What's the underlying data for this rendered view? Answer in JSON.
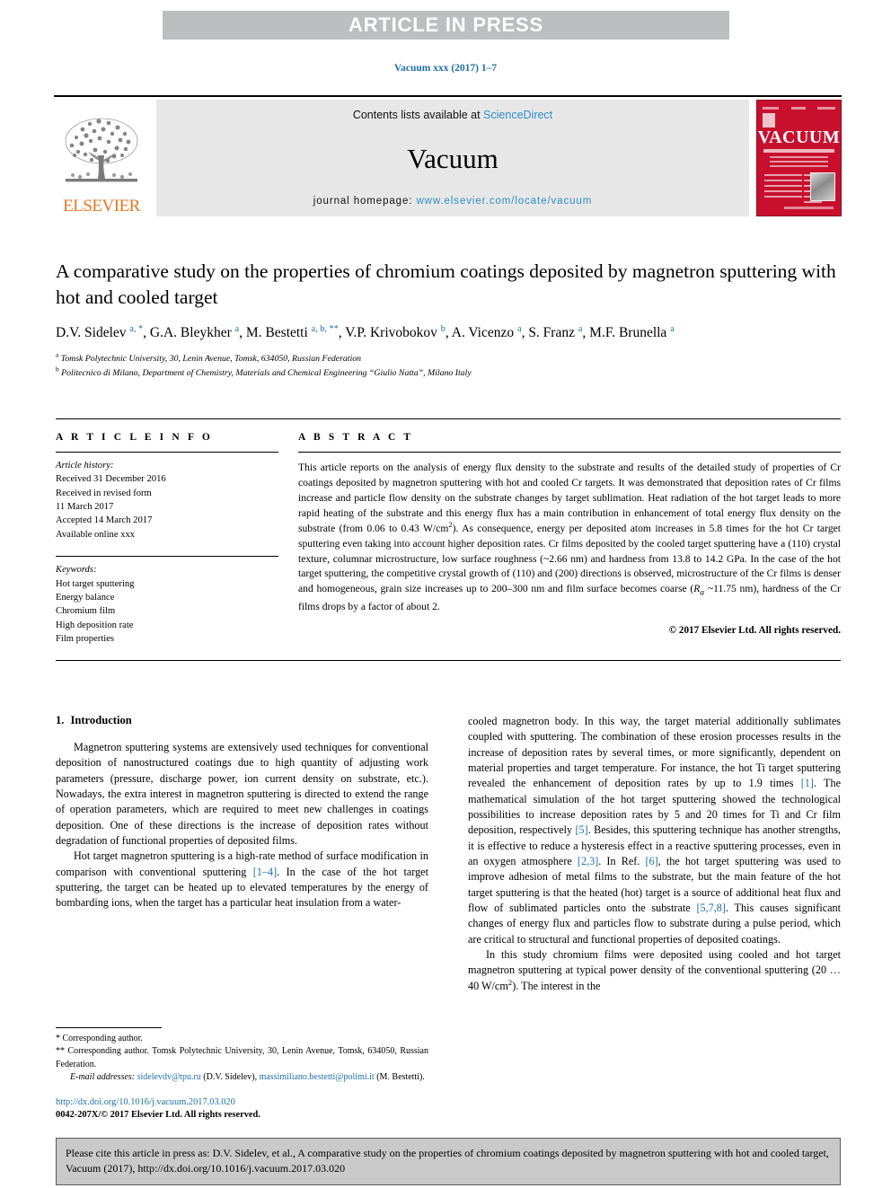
{
  "banner": {
    "text": "ARTICLE IN PRESS"
  },
  "running_head": "Vacuum xxx (2017) 1–7",
  "masthead": {
    "publisher": "ELSEVIER",
    "contents_prefix": "Contents lists available at ",
    "contents_link": "ScienceDirect",
    "journal_title": "Vacuum",
    "homepage_prefix": "journal homepage: ",
    "homepage_url": "www.elsevier.com/locate/vacuum",
    "cover_title": "VACUUM",
    "brand_red": "#c8102e",
    "brand_orange": "#e87722",
    "link_blue": "#2b8ec4"
  },
  "article": {
    "title": "A comparative study on the properties of chromium coatings deposited by magnetron sputtering with hot and cooled target",
    "authors_html": "D.V. Sidelev <sup>a, *</sup>, G.A. Bleykher <sup>a</sup>, M. Bestetti <sup>a, b, **</sup>, V.P. Krivobokov <sup>b</sup>, A. Vicenzo <sup>a</sup>, S. Franz <sup>a</sup>, M.F. Brunella <sup>a</sup>",
    "affiliation_a": "Tomsk Polytechnic University, 30, Lenin Avenue, Tomsk, 634050, Russian Federation",
    "affiliation_b": "Politecnico di Milano, Department of Chemistry, Materials and Chemical Engineering “Giulio Natta”, Milano Italy"
  },
  "info": {
    "heading": "A R T I C L E   I N F O",
    "history_label": "Article history:",
    "history": [
      "Received 31 December 2016",
      "Received in revised form",
      "11 March 2017",
      "Accepted 14 March 2017",
      "Available online xxx"
    ],
    "keywords_label": "Keywords:",
    "keywords": [
      "Hot target sputtering",
      "Energy balance",
      "Chromium film",
      "High deposition rate",
      "Film properties"
    ]
  },
  "abstract": {
    "heading": "A B S T R A C T",
    "text_html": "This article reports on the analysis of energy flux density to the substrate and results of the detailed study of properties of Cr coatings deposited by magnetron sputtering with hot and cooled Cr targets. It was demonstrated that deposition rates of Cr films increase and particle flow density on the substrate changes by target sublimation. Heat radiation of the hot target leads to more rapid heating of the substrate and this energy flux has a main contribution in enhancement of total energy flux density on the substrate (from 0.06 to 0.43 W/cm<sup>2</sup>). As consequence, energy per deposited atom increases in 5.8 times for the hot Cr target sputtering even taking into account higher deposition rates. Cr films deposited by the cooled target sputtering have a (110) crystal texture, columnar microstructure, low surface roughness (~2.66 nm) and hardness from 13.8 to 14.2 GPa. In the case of the hot target sputtering, the competitive crystal growth of (110) and (200) directions is observed, microstructure of the Cr films is denser and homogeneous, grain size increases up to 200–300 nm and film surface becomes coarse (<i>R<sub>a</sub></i> ~11.75 nm), hardness of the Cr films drops by a factor of about 2.",
    "copyright": "© 2017 Elsevier Ltd. All rights reserved."
  },
  "introduction": {
    "number": "1.",
    "heading": "Introduction",
    "left_paragraphs_html": [
      "Magnetron sputtering systems are extensively used techniques for conventional deposition of nanostructured coatings due to high quantity of adjusting work parameters (pressure, discharge power, ion current density on substrate, etc.). Nowadays, the extra interest in magnetron sputtering is directed to extend the range of operation parameters, which are required to meet new challenges in coatings deposition. One of these directions is the increase of deposition rates without degradation of functional properties of deposited films.",
      "Hot target magnetron sputtering is a high-rate method of surface modification in comparison with conventional sputtering <span class=\"ref\">[1–4]</span>. In the case of the hot target sputtering, the target can be heated up to elevated temperatures by the energy of bombarding ions, when the target has a particular heat insulation from a water-"
    ],
    "right_paragraphs_html": [
      "cooled magnetron body. In this way, the target material additionally sublimates coupled with sputtering. The combination of these erosion processes results in the increase of deposition rates by several times, or more significantly, dependent on material properties and target temperature. For instance, the hot Ti target sputtering revealed the enhancement of deposition rates by up to 1.9 times <span class=\"ref\">[1]</span>. The mathematical simulation of the hot target sputtering showed the technological possibilities to increase deposition rates by 5 and 20 times for Ti and Cr film deposition, respectively <span class=\"ref\">[5]</span>. Besides, this sputtering technique has another strengths, it is effective to reduce a hysteresis effect in a reactive sputtering processes, even in an oxygen atmosphere <span class=\"ref\">[2,3]</span>. In Ref. <span class=\"ref\">[6]</span>, the hot target sputtering was used to improve adhesion of metal films to the substrate, but the main feature of the hot target sputtering is that the heated (hot) target is a source of additional heat flux and flow of sublimated particles onto the substrate <span class=\"ref\">[5,7,8]</span>. This causes significant changes of energy flux and particles flow to substrate during a pulse period, which are critical to structural and functional properties of deposited coatings.",
      "In this study chromium films were deposited using cooled and hot target magnetron sputtering at typical power density of the conventional sputtering (20 … 40 W/cm<sup>2</sup>). The interest in the"
    ]
  },
  "footnotes": {
    "corresponding_1_html": "<span class=\"mark\">*</span> Corresponding author.",
    "corresponding_2_html": "<span class=\"mark\">**</span> Corresponding author. Tomsk Polytechnic University, 30, Lenin Avenue, Tomsk, 634050, Russian Federation.",
    "emails_html": "<i>E-mail addresses:</i> <span class=\"link\">sidelevdv@tpu.ru</span> (D.V. Sidelev), <span class=\"link\">massimiliano.bestetti@polimi.it</span> (M. Bestetti).",
    "doi": "http://dx.doi.org/10.1016/j.vacuum.2017.03.020",
    "issn": "0042-207X/© 2017 Elsevier Ltd. All rights reserved."
  },
  "cite_footer": {
    "text": "Please cite this article in press as: D.V. Sidelev, et al., A comparative study on the properties of chromium coatings deposited by magnetron sputtering with hot and cooled target, Vacuum (2017), http://dx.doi.org/10.1016/j.vacuum.2017.03.020"
  }
}
